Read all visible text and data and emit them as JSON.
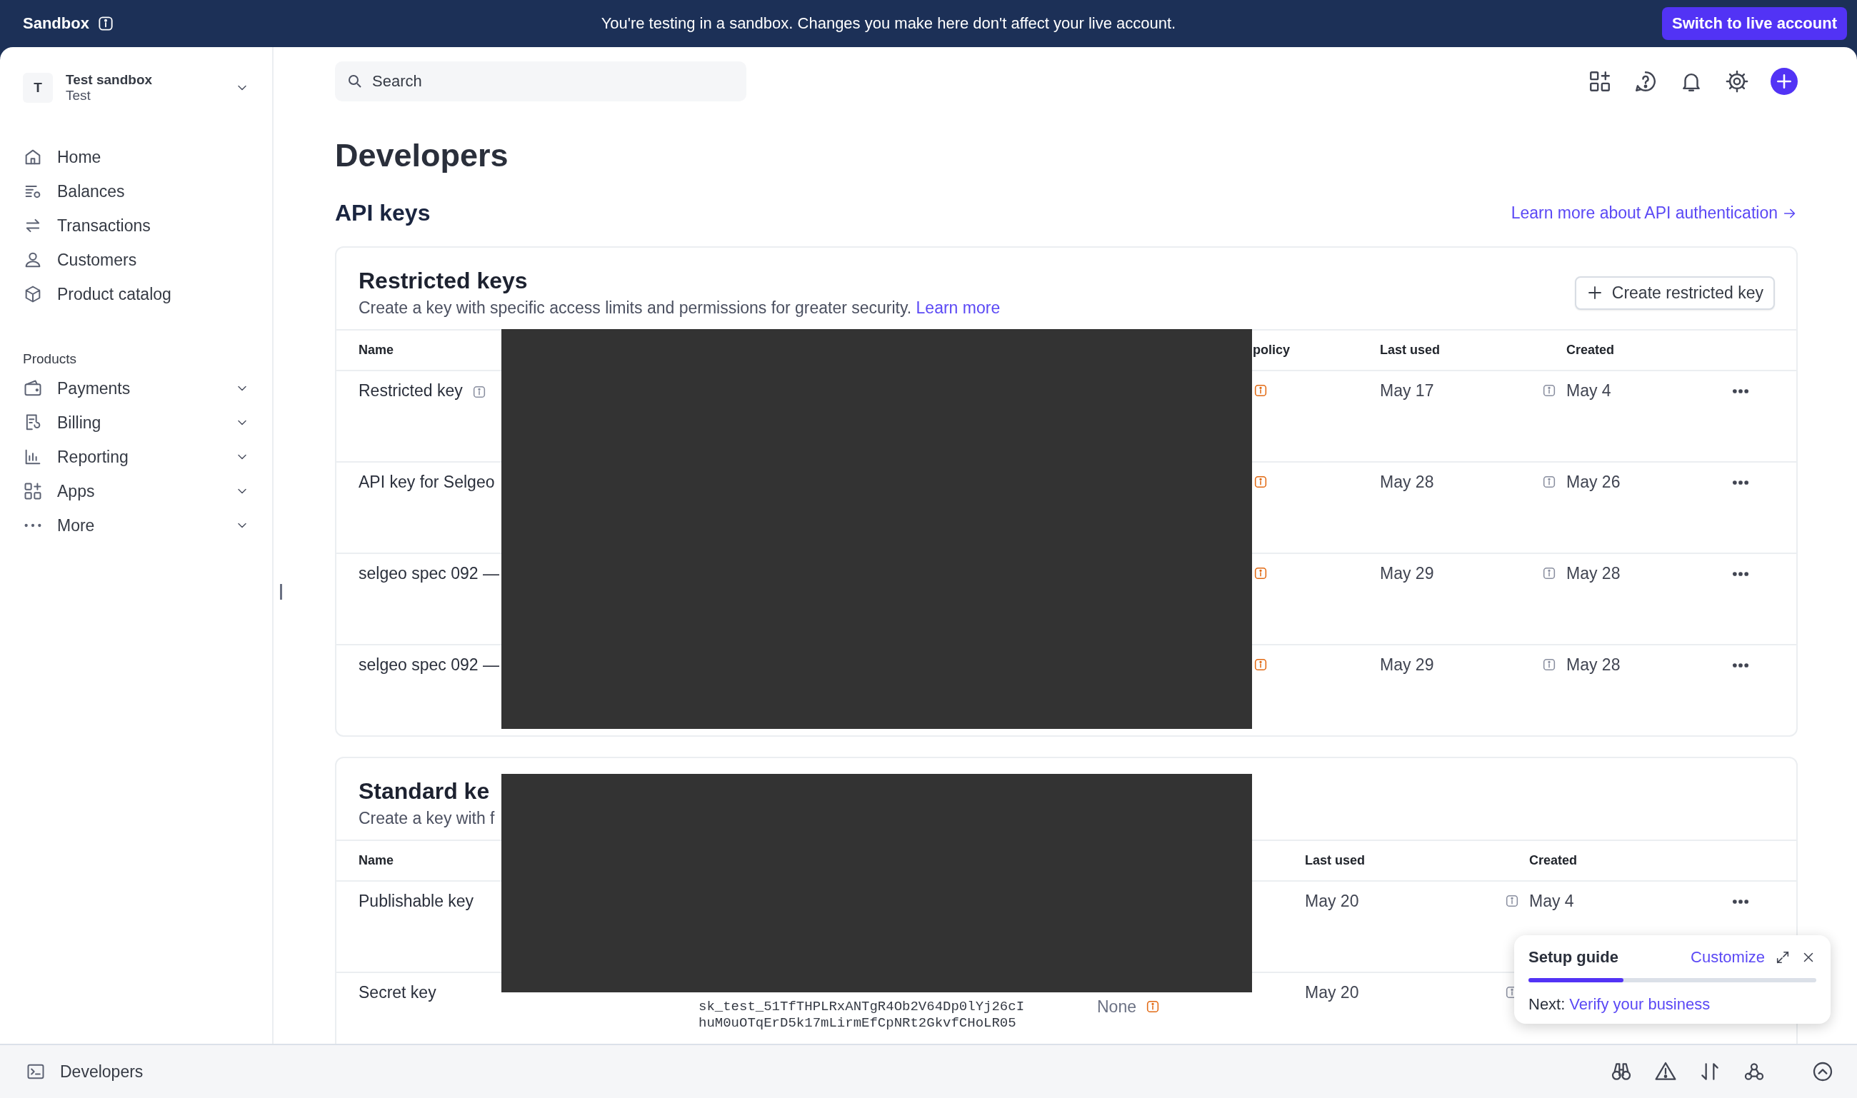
{
  "banner": {
    "title": "Sandbox",
    "message": "You're testing in a sandbox. Changes you make here don't affect your live account.",
    "button": "Switch to live account"
  },
  "account": {
    "initial": "T",
    "name": "Test sandbox",
    "mode": "Test"
  },
  "nav": [
    {
      "label": "Home"
    },
    {
      "label": "Balances"
    },
    {
      "label": "Transactions"
    },
    {
      "label": "Customers"
    },
    {
      "label": "Product catalog"
    }
  ],
  "products_heading": "Products",
  "products": [
    {
      "label": "Payments"
    },
    {
      "label": "Billing"
    },
    {
      "label": "Reporting"
    },
    {
      "label": "Apps"
    },
    {
      "label": "More"
    }
  ],
  "search": {
    "placeholder": "Search"
  },
  "page_title": "Developers",
  "section_title": "API keys",
  "section_link": "Learn more about API authentication",
  "restricted": {
    "title": "Restricted keys",
    "description": "Create a key with specific access limits and permissions for greater security.",
    "link": "Learn more",
    "button": "Create restricted key",
    "columns": [
      "Name",
      "policy",
      "Last used",
      "Created"
    ],
    "rows": [
      {
        "name": "Restricted key",
        "info": true,
        "last_used": "May 17",
        "created": "May 4"
      },
      {
        "name": "API key for Selgeo",
        "info": false,
        "last_used": "May 28",
        "created": "May 26"
      },
      {
        "name": "selgeo spec 092 —",
        "info": false,
        "last_used": "May 29",
        "created": "May 28"
      },
      {
        "name": "selgeo spec 092 —",
        "info": false,
        "last_used": "May 29",
        "created": "May 28"
      }
    ]
  },
  "standard": {
    "title": "Standard ke",
    "description": "Create a key with f",
    "columns": [
      "Name",
      "Last used",
      "Created"
    ],
    "rows": [
      {
        "name": "Publishable key",
        "last_used": "May 20",
        "created": "May 4"
      },
      {
        "name": "Secret key",
        "token": [
          "sk_test_51TfTHPLRxANTgR4Ob2V64Dp0lYj26cI",
          "huM0uOTqErD5k17mLirmEfCpNRt2GkvfCHoLR05"
        ],
        "restrictions": "None",
        "last_used": "May 20"
      }
    ]
  },
  "setup_guide": {
    "title": "Setup guide",
    "action": "Customize",
    "level": 0.33,
    "next_label": "Next:",
    "next_link": "Verify your business"
  },
  "footer": {
    "label": "Developers"
  }
}
